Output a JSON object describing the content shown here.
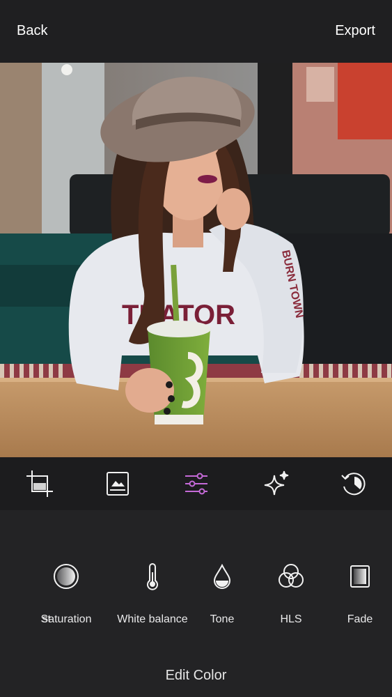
{
  "topbar": {
    "back_label": "Back",
    "export_label": "Export"
  },
  "photo": {
    "sweater_text": "TRATOR",
    "sleeve_text": "BURN TOWN"
  },
  "tools": {
    "icons": [
      "crop-icon",
      "image-frame-icon",
      "sliders-icon",
      "sparkle-icon",
      "history-icon"
    ],
    "active": "sliders-icon",
    "active_color": "#c56ad8"
  },
  "adjustments": {
    "items": [
      {
        "label": "st",
        "icon": "contrast-icon"
      },
      {
        "label": "Saturation",
        "icon": "saturation-icon"
      },
      {
        "label": "White balance",
        "icon": "thermometer-icon"
      },
      {
        "label": "Tone",
        "icon": "droplet-icon"
      },
      {
        "label": "HLS",
        "icon": "hls-circles-icon"
      },
      {
        "label": "Fade",
        "icon": "fade-icon"
      }
    ]
  },
  "panel": {
    "title": "Edit Color"
  }
}
